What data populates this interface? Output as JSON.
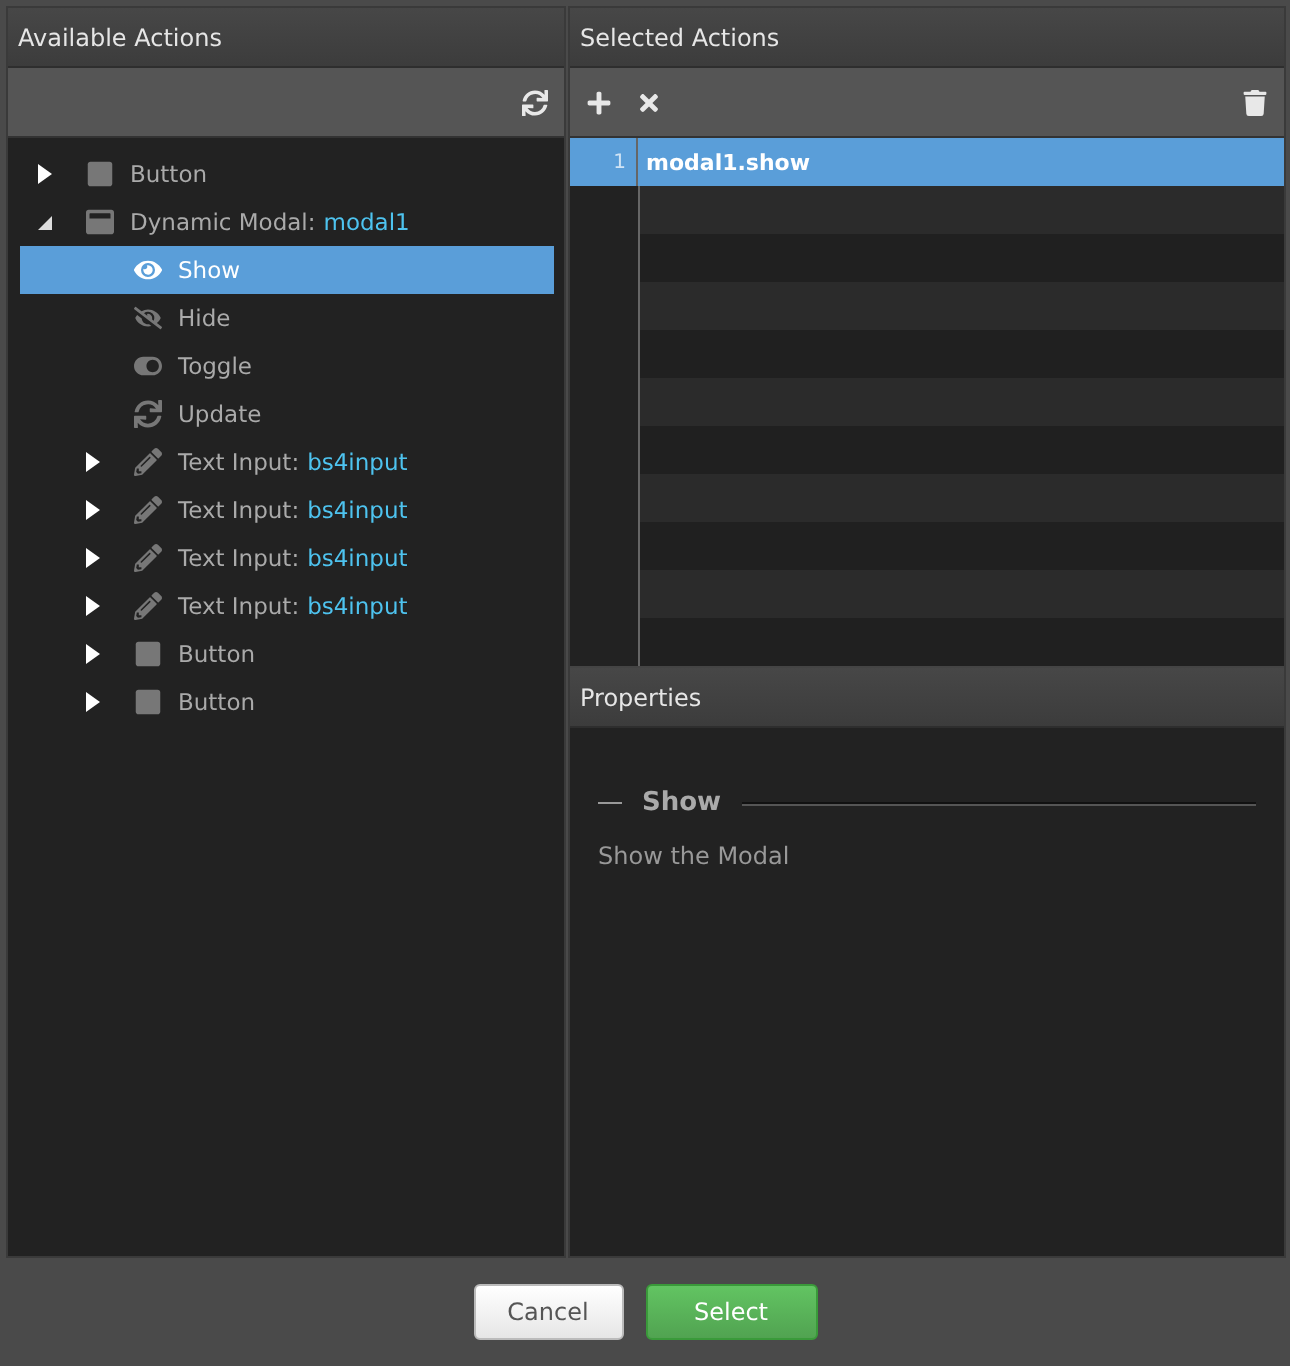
{
  "available_actions": {
    "title": "Available Actions",
    "tree": [
      {
        "kind": "button",
        "label": "Button",
        "expanded": false,
        "selected": false
      },
      {
        "kind": "modal",
        "label": "Dynamic Modal:",
        "name": "modal1",
        "expanded": true,
        "selected": false,
        "children": [
          {
            "kind": "show",
            "label": "Show",
            "selected": true
          },
          {
            "kind": "hide",
            "label": "Hide",
            "selected": false
          },
          {
            "kind": "toggle",
            "label": "Toggle",
            "selected": false
          },
          {
            "kind": "update",
            "label": "Update",
            "selected": false
          },
          {
            "kind": "text-input",
            "label": "Text Input:",
            "name": "bs4input",
            "expanded": false,
            "selected": false
          },
          {
            "kind": "text-input",
            "label": "Text Input:",
            "name": "bs4input",
            "expanded": false,
            "selected": false
          },
          {
            "kind": "text-input",
            "label": "Text Input:",
            "name": "bs4input",
            "expanded": false,
            "selected": false
          },
          {
            "kind": "text-input",
            "label": "Text Input:",
            "name": "bs4input",
            "expanded": false,
            "selected": false
          },
          {
            "kind": "button",
            "label": "Button",
            "expanded": false,
            "selected": false
          },
          {
            "kind": "button",
            "label": "Button",
            "expanded": false,
            "selected": false
          }
        ]
      }
    ]
  },
  "selected_actions": {
    "title": "Selected Actions",
    "rows": [
      {
        "line": "1",
        "text": "modal1.show",
        "selected": true
      }
    ]
  },
  "properties": {
    "title": "Properties",
    "section": "Show",
    "description": "Show the Modal"
  },
  "buttons": [
    {
      "kind": "default",
      "label": "Cancel"
    },
    {
      "kind": "primary",
      "label": "Select"
    }
  ]
}
